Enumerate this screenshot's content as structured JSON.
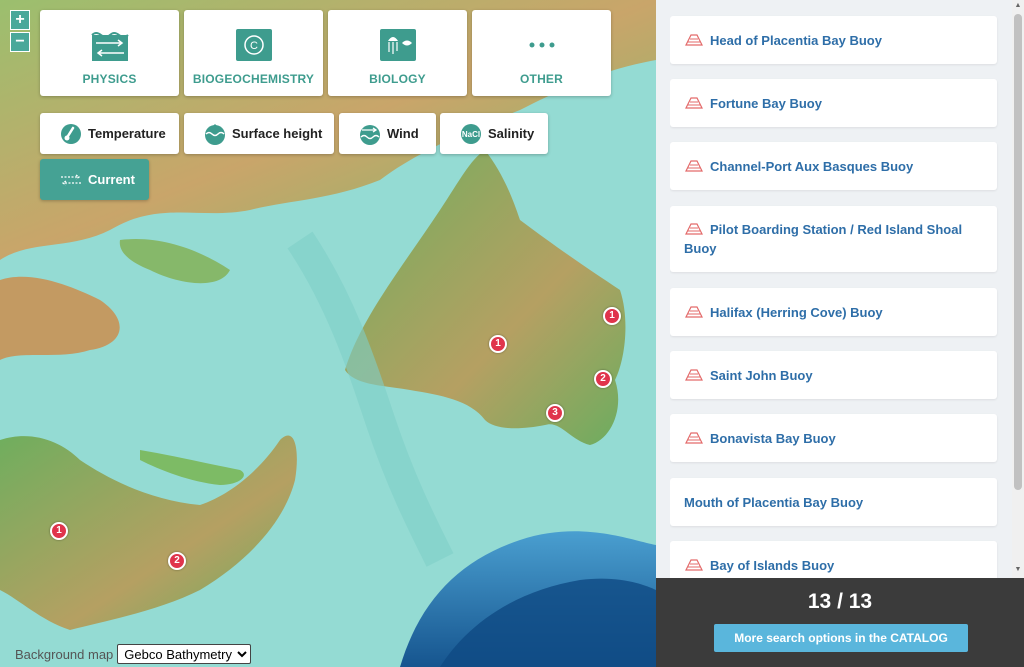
{
  "map": {
    "zoom_in": "+",
    "zoom_out": "−",
    "categories": [
      {
        "label": "PHYSICS",
        "icon": "physics-icon"
      },
      {
        "label": "BIOGEOCHEMISTRY",
        "icon": "biogeochemistry-icon"
      },
      {
        "label": "BIOLOGY",
        "icon": "biology-icon"
      },
      {
        "label": "OTHER",
        "icon": "more-dots-icon"
      }
    ],
    "subcategories": [
      {
        "label": "Temperature",
        "icon": "thermometer-icon"
      },
      {
        "label": "Surface height",
        "icon": "surface-height-icon"
      },
      {
        "label": "Wind",
        "icon": "wind-icon"
      },
      {
        "label": "Salinity",
        "icon": "salinity-icon",
        "icon_text": "NaCl"
      },
      {
        "label": "Current",
        "icon": "current-icon",
        "active": true
      }
    ],
    "markers": [
      "1",
      "1",
      "2",
      "3",
      "1",
      "2"
    ],
    "background_map_label": "Background map",
    "background_map_value": "Gebco Bathymetry",
    "colors": {
      "accent": "#45a294",
      "marker": "#e0344c"
    }
  },
  "panel": {
    "stations": [
      {
        "name": "Head of Placentia Bay Buoy",
        "has_icon": true
      },
      {
        "name": "Fortune Bay Buoy",
        "has_icon": true
      },
      {
        "name": "Channel-Port Aux Basques Buoy",
        "has_icon": true
      },
      {
        "name": "Pilot Boarding Station / Red Island Shoal Buoy",
        "has_icon": true
      },
      {
        "name": "Halifax (Herring Cove) Buoy",
        "has_icon": true
      },
      {
        "name": "Saint John Buoy",
        "has_icon": true
      },
      {
        "name": "Bonavista Bay Buoy",
        "has_icon": true
      },
      {
        "name": "Mouth of Placentia Bay Buoy",
        "has_icon": false
      },
      {
        "name": "Bay of Islands Buoy",
        "has_icon": true
      }
    ],
    "count": "13 / 13",
    "more_button": "More search options in the CATALOG",
    "colors": {
      "title": "#2e6ea8",
      "button": "#5ab6dc"
    }
  }
}
